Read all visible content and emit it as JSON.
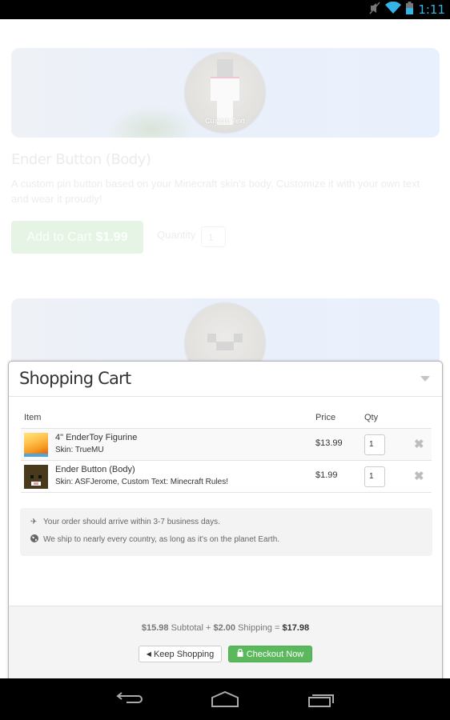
{
  "status_bar": {
    "time": "1:11",
    "icons": [
      "mute-icon",
      "wifi-icon",
      "battery-icon"
    ]
  },
  "product": {
    "image_text": "Custom Text",
    "title": "Ender Button (Body)",
    "description": "A custom pin button based on your Minecraft skin's body. Customize it with your own text and wear it proudly!",
    "add_to_cart_label": "Add to Cart",
    "add_to_cart_price": "$1.99",
    "quantity_label": "Quantity",
    "quantity_value": "1"
  },
  "cart": {
    "title": "Shopping Cart",
    "columns": {
      "item": "Item",
      "price": "Price",
      "qty": "Qty"
    },
    "items": [
      {
        "name": "4\" EnderToy Figurine",
        "detail": "Skin: TrueMU",
        "price": "$13.99",
        "qty": "1"
      },
      {
        "name": "Ender Button (Body)",
        "detail": "Skin: ASFJerome, Custom Text: Minecraft Rules!",
        "price": "$1.99",
        "qty": "1"
      }
    ],
    "info": [
      {
        "icon": "plane-icon",
        "text": "Your order should arrive within 3-7 business days."
      },
      {
        "icon": "globe-icon",
        "text": "We ship to nearly every country, as long as it's on the planet Earth."
      }
    ],
    "totals": {
      "subtotal": "$15.98",
      "subtotal_label": "Subtotal +",
      "shipping": "$2.00",
      "shipping_label": "Shipping =",
      "total": "$17.98"
    },
    "keep_shopping_label": "Keep Shopping",
    "checkout_label": "Checkout Now"
  },
  "colors": {
    "accent_green": "#5cb85c",
    "status_blue": "#33b5e5"
  }
}
